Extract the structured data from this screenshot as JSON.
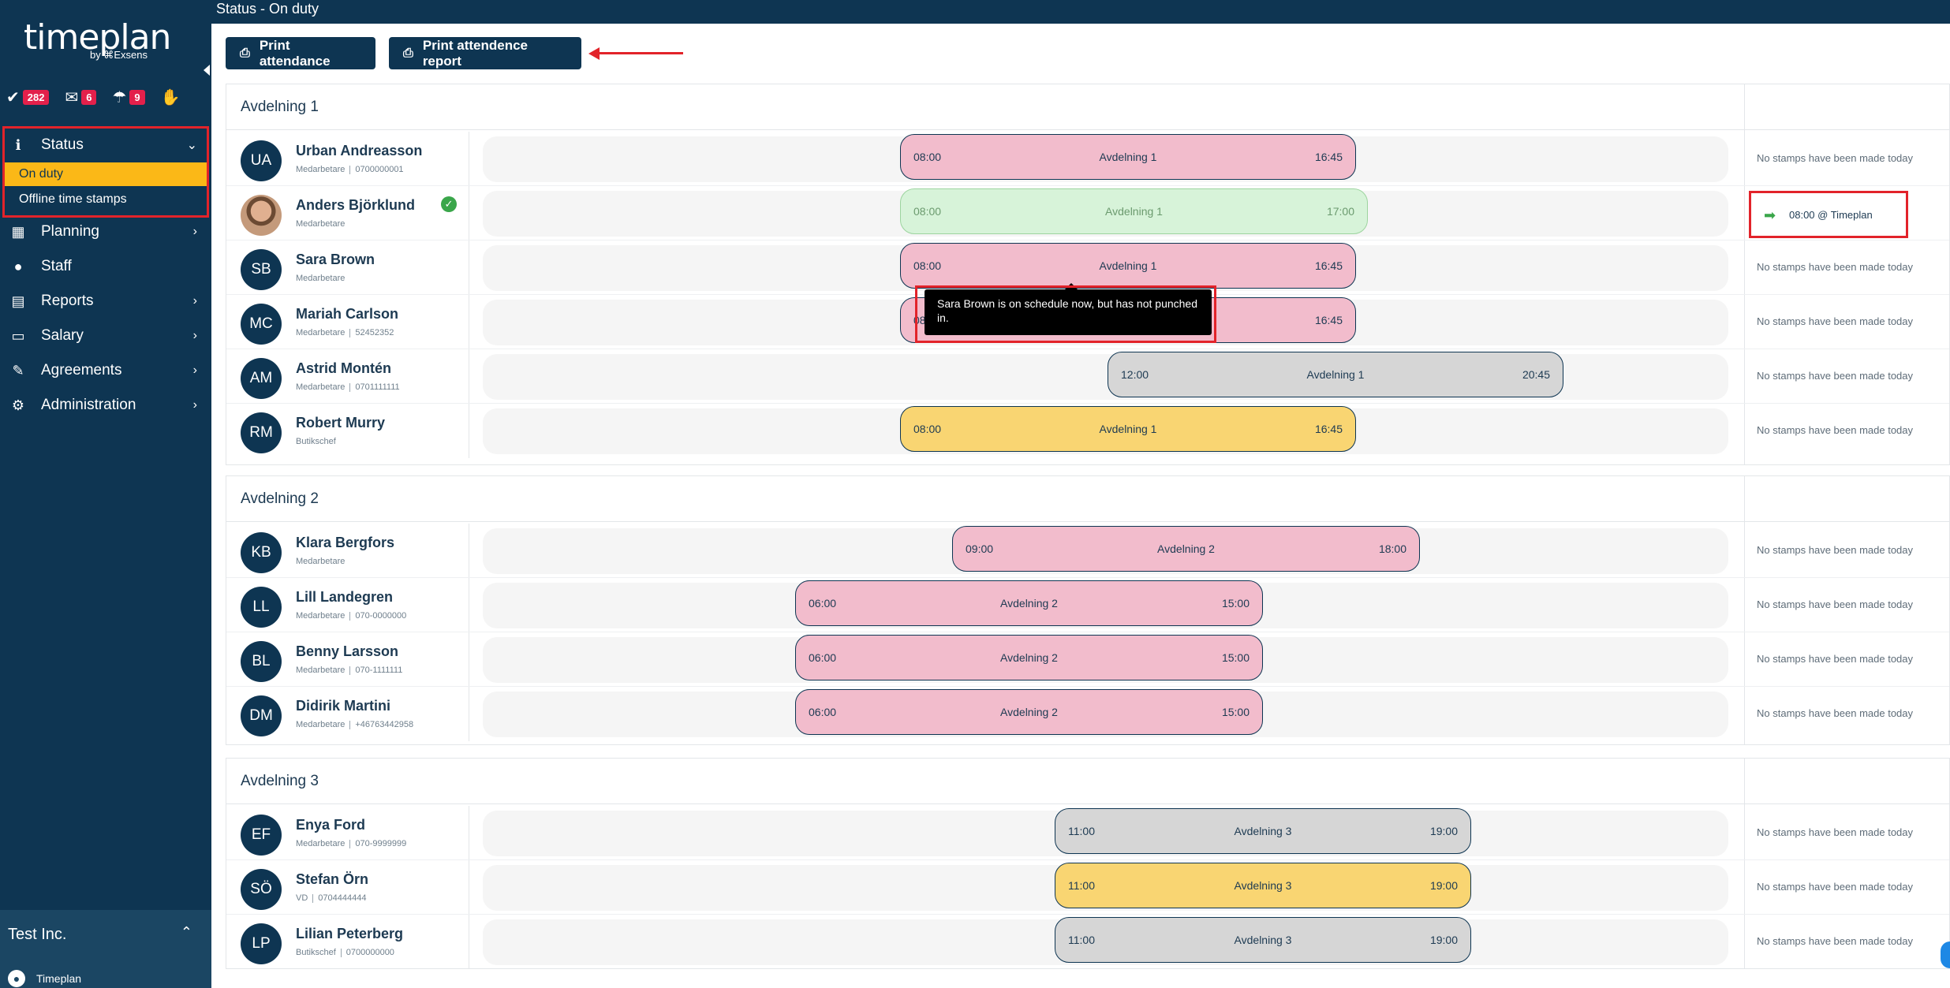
{
  "app": {
    "logo_text": "timeplan",
    "logo_by": "by ⌘Exsens",
    "page_title": "Status - On duty"
  },
  "counters": [
    {
      "icon": "check-icon",
      "count": "282"
    },
    {
      "icon": "mail-icon",
      "count": "6"
    },
    {
      "icon": "umbrella-icon",
      "count": "9"
    },
    {
      "icon": "badge-icon",
      "count": ""
    }
  ],
  "sidebar": {
    "items": [
      {
        "icon": "info-icon",
        "label": "Status"
      },
      {
        "label": "On duty"
      },
      {
        "label": "Offline time stamps"
      },
      {
        "icon": "calendar-icon",
        "label": "Planning"
      },
      {
        "icon": "user-icon",
        "label": "Staff"
      },
      {
        "icon": "document-icon",
        "label": "Reports"
      },
      {
        "icon": "money-icon",
        "label": "Salary"
      },
      {
        "icon": "wrench-icon",
        "label": "Agreements"
      },
      {
        "icon": "cogs-icon",
        "label": "Administration"
      }
    ],
    "company": "Test Inc.",
    "user": "Timeplan"
  },
  "toolbar": {
    "print_attendance": "Print attendance",
    "print_report": "Print attendence report"
  },
  "no_stamps": "No stamps have been made today",
  "tooltip": "Sara Brown is on schedule now, but has not punched in.",
  "stamp": {
    "text": "08:00 @ Timeplan"
  },
  "departments": [
    {
      "name": "Avdelning 1",
      "employees": [
        {
          "initials": "UA",
          "name": "Urban Andreasson",
          "role": "Medarbetare",
          "phone": "0700000001",
          "start": "08:00",
          "dept": "Avdelning 1",
          "end": "16:45",
          "color": "pink"
        },
        {
          "initials": "",
          "name": "Anders Björklund",
          "role": "Medarbetare",
          "phone": "",
          "start": "08:00",
          "dept": "Avdelning 1",
          "end": "17:00",
          "color": "green"
        },
        {
          "initials": "SB",
          "name": "Sara Brown",
          "role": "Medarbetare",
          "phone": "",
          "start": "08:00",
          "dept": "Avdelning 1",
          "end": "16:45",
          "color": "pink"
        },
        {
          "initials": "MC",
          "name": "Mariah Carlson",
          "role": "Medarbetare",
          "phone": "52452352",
          "start": "08",
          "dept": "",
          "end": "16:45",
          "color": "pink"
        },
        {
          "initials": "AM",
          "name": "Astrid Montén",
          "role": "Medarbetare",
          "phone": "0701111111",
          "start": "12:00",
          "dept": "Avdelning 1",
          "end": "20:45",
          "color": "grey"
        },
        {
          "initials": "RM",
          "name": "Robert Murry",
          "role": "Butikschef",
          "phone": "",
          "start": "08:00",
          "dept": "Avdelning 1",
          "end": "16:45",
          "color": "yellow"
        }
      ]
    },
    {
      "name": "Avdelning 2",
      "employees": [
        {
          "initials": "KB",
          "name": "Klara Bergfors",
          "role": "Medarbetare",
          "phone": "",
          "start": "09:00",
          "dept": "Avdelning 2",
          "end": "18:00",
          "color": "pink"
        },
        {
          "initials": "LL",
          "name": "Lill Landegren",
          "role": "Medarbetare",
          "phone": "070-0000000",
          "start": "06:00",
          "dept": "Avdelning 2",
          "end": "15:00",
          "color": "pink"
        },
        {
          "initials": "BL",
          "name": "Benny Larsson",
          "role": "Medarbetare",
          "phone": "070-1111111",
          "start": "06:00",
          "dept": "Avdelning 2",
          "end": "15:00",
          "color": "pink"
        },
        {
          "initials": "DM",
          "name": "Didirik Martini",
          "role": "Medarbetare",
          "phone": "+46763442958",
          "start": "06:00",
          "dept": "Avdelning 2",
          "end": "15:00",
          "color": "pink"
        }
      ]
    },
    {
      "name": "Avdelning 3",
      "employees": [
        {
          "initials": "EF",
          "name": "Enya Ford",
          "role": "Medarbetare",
          "phone": "070-9999999",
          "start": "11:00",
          "dept": "Avdelning 3",
          "end": "19:00",
          "color": "grey"
        },
        {
          "initials": "SÖ",
          "name": "Stefan Örn",
          "role": "VD",
          "phone": "0704444444",
          "start": "11:00",
          "dept": "Avdelning 3",
          "end": "19:00",
          "color": "yellow"
        },
        {
          "initials": "LP",
          "name": "Lilian Peterberg",
          "role": "Butikschef",
          "phone": "0700000000",
          "start": "11:00",
          "dept": "Avdelning 3",
          "end": "19:00",
          "color": "grey"
        }
      ]
    }
  ]
}
